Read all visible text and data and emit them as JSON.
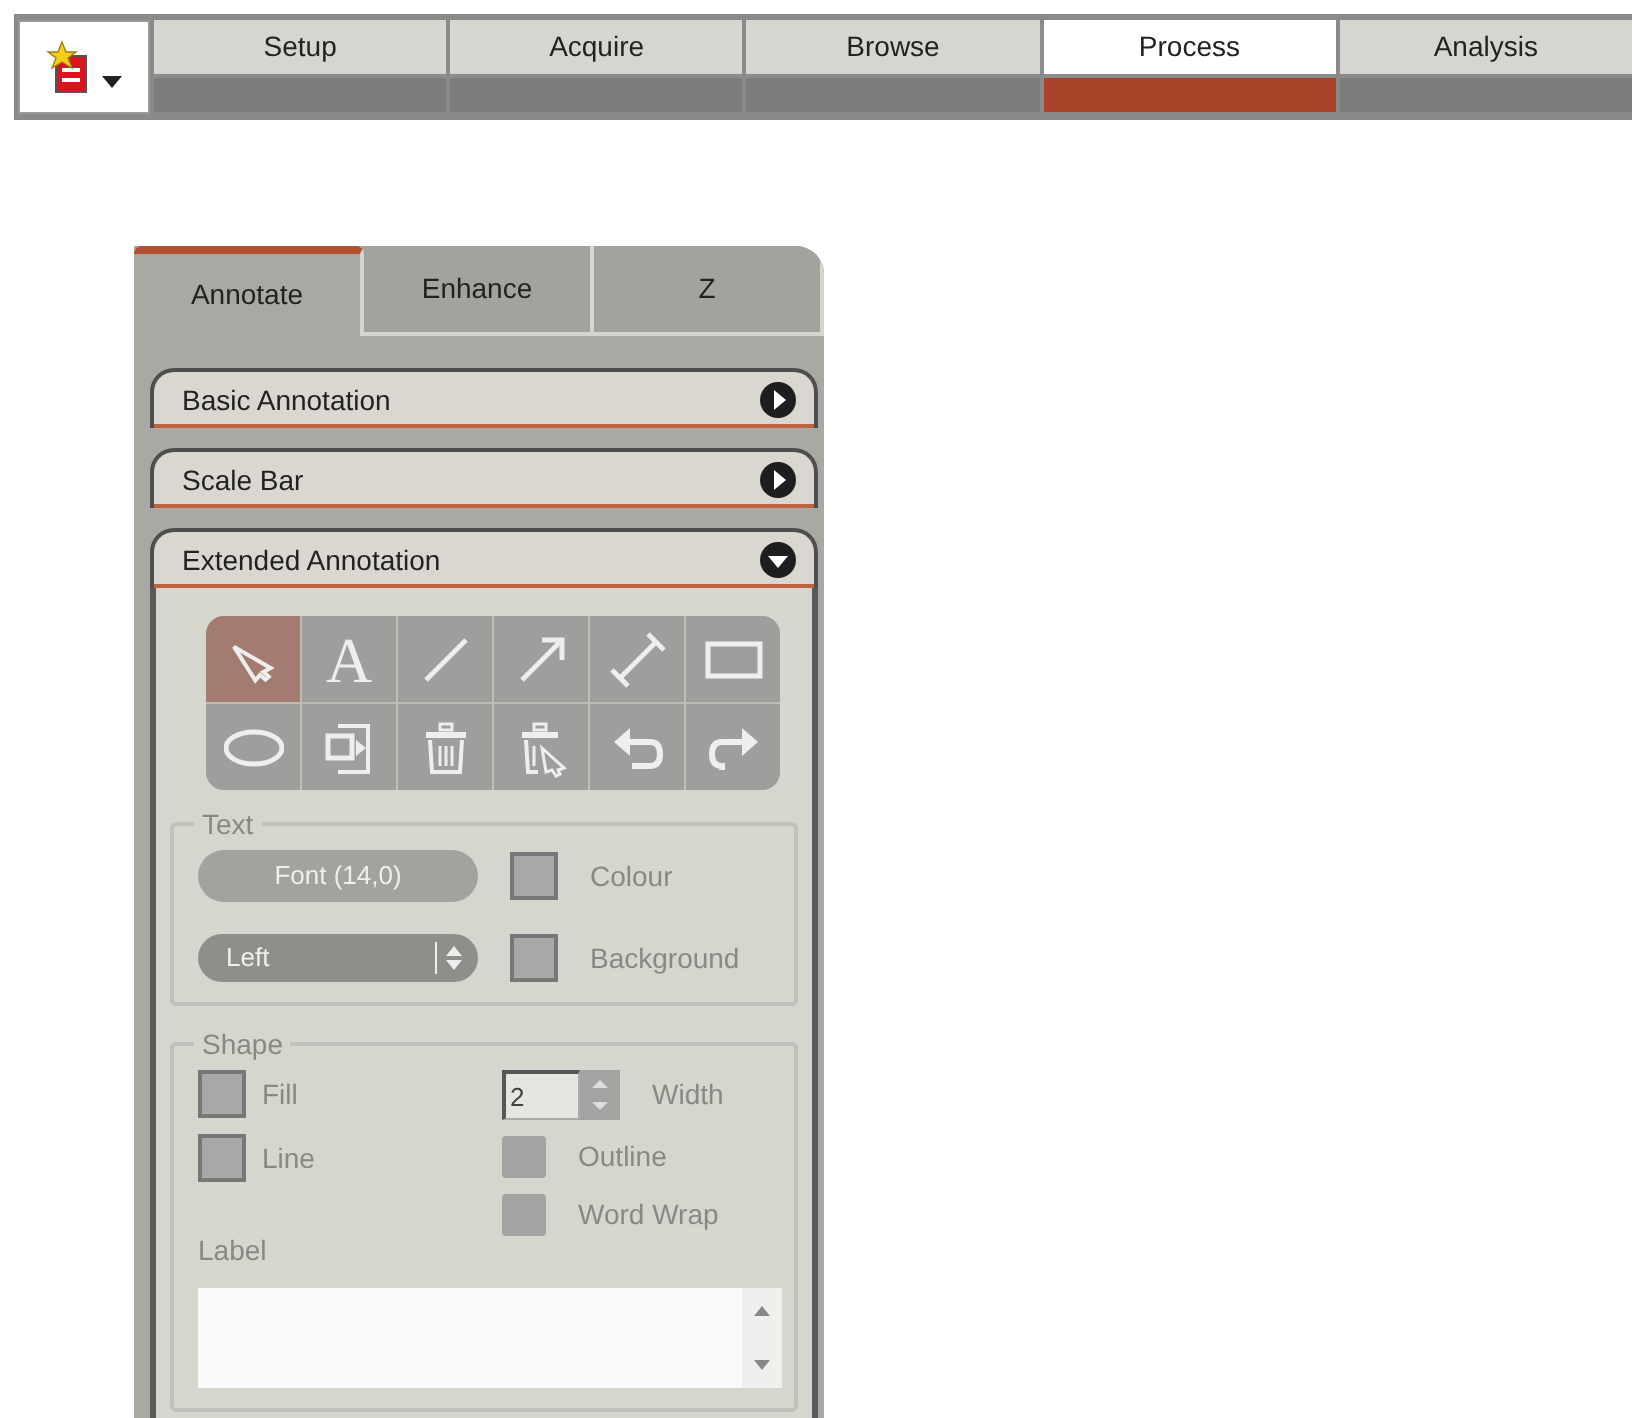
{
  "app_button": {
    "has_menu": true
  },
  "nav_tabs": [
    {
      "label": "Setup",
      "selected": false
    },
    {
      "label": "Acquire",
      "selected": false
    },
    {
      "label": "Browse",
      "selected": false
    },
    {
      "label": "Process",
      "selected": true
    },
    {
      "label": "Analysis",
      "selected": false
    }
  ],
  "panel_tabs": [
    {
      "label": "Annotate",
      "selected": true
    },
    {
      "label": "Enhance",
      "selected": false
    },
    {
      "label": "Z",
      "selected": false
    }
  ],
  "sections": [
    {
      "title": "Basic Annotation",
      "expanded": false
    },
    {
      "title": "Scale Bar",
      "expanded": false
    },
    {
      "title": "Extended Annotation",
      "expanded": true
    }
  ],
  "tools": [
    {
      "kind": "pointer",
      "selected": true
    },
    {
      "kind": "text",
      "label": "A",
      "selected": false
    },
    {
      "kind": "line",
      "selected": false
    },
    {
      "kind": "arrow",
      "selected": false
    },
    {
      "kind": "measure",
      "selected": false
    },
    {
      "kind": "rectangle",
      "selected": false
    },
    {
      "kind": "ellipse",
      "selected": false
    },
    {
      "kind": "insert",
      "selected": false
    },
    {
      "kind": "delete",
      "selected": false
    },
    {
      "kind": "delete-selected",
      "selected": false
    },
    {
      "kind": "undo",
      "selected": false
    },
    {
      "kind": "redo",
      "selected": false
    }
  ],
  "text_group": {
    "title": "Text",
    "disabled": true,
    "font_button": "Font (14,0)",
    "colour_label": "Colour",
    "align_select": "Left",
    "background_label": "Background"
  },
  "shape_group": {
    "title": "Shape",
    "disabled": true,
    "fill_label": "Fill",
    "line_label": "Line",
    "width_value": "2",
    "width_label": "Width",
    "outline_label": "Outline",
    "outline_checked": false,
    "word_wrap_label": "Word Wrap",
    "word_wrap_checked": false,
    "label_caption": "Label"
  }
}
